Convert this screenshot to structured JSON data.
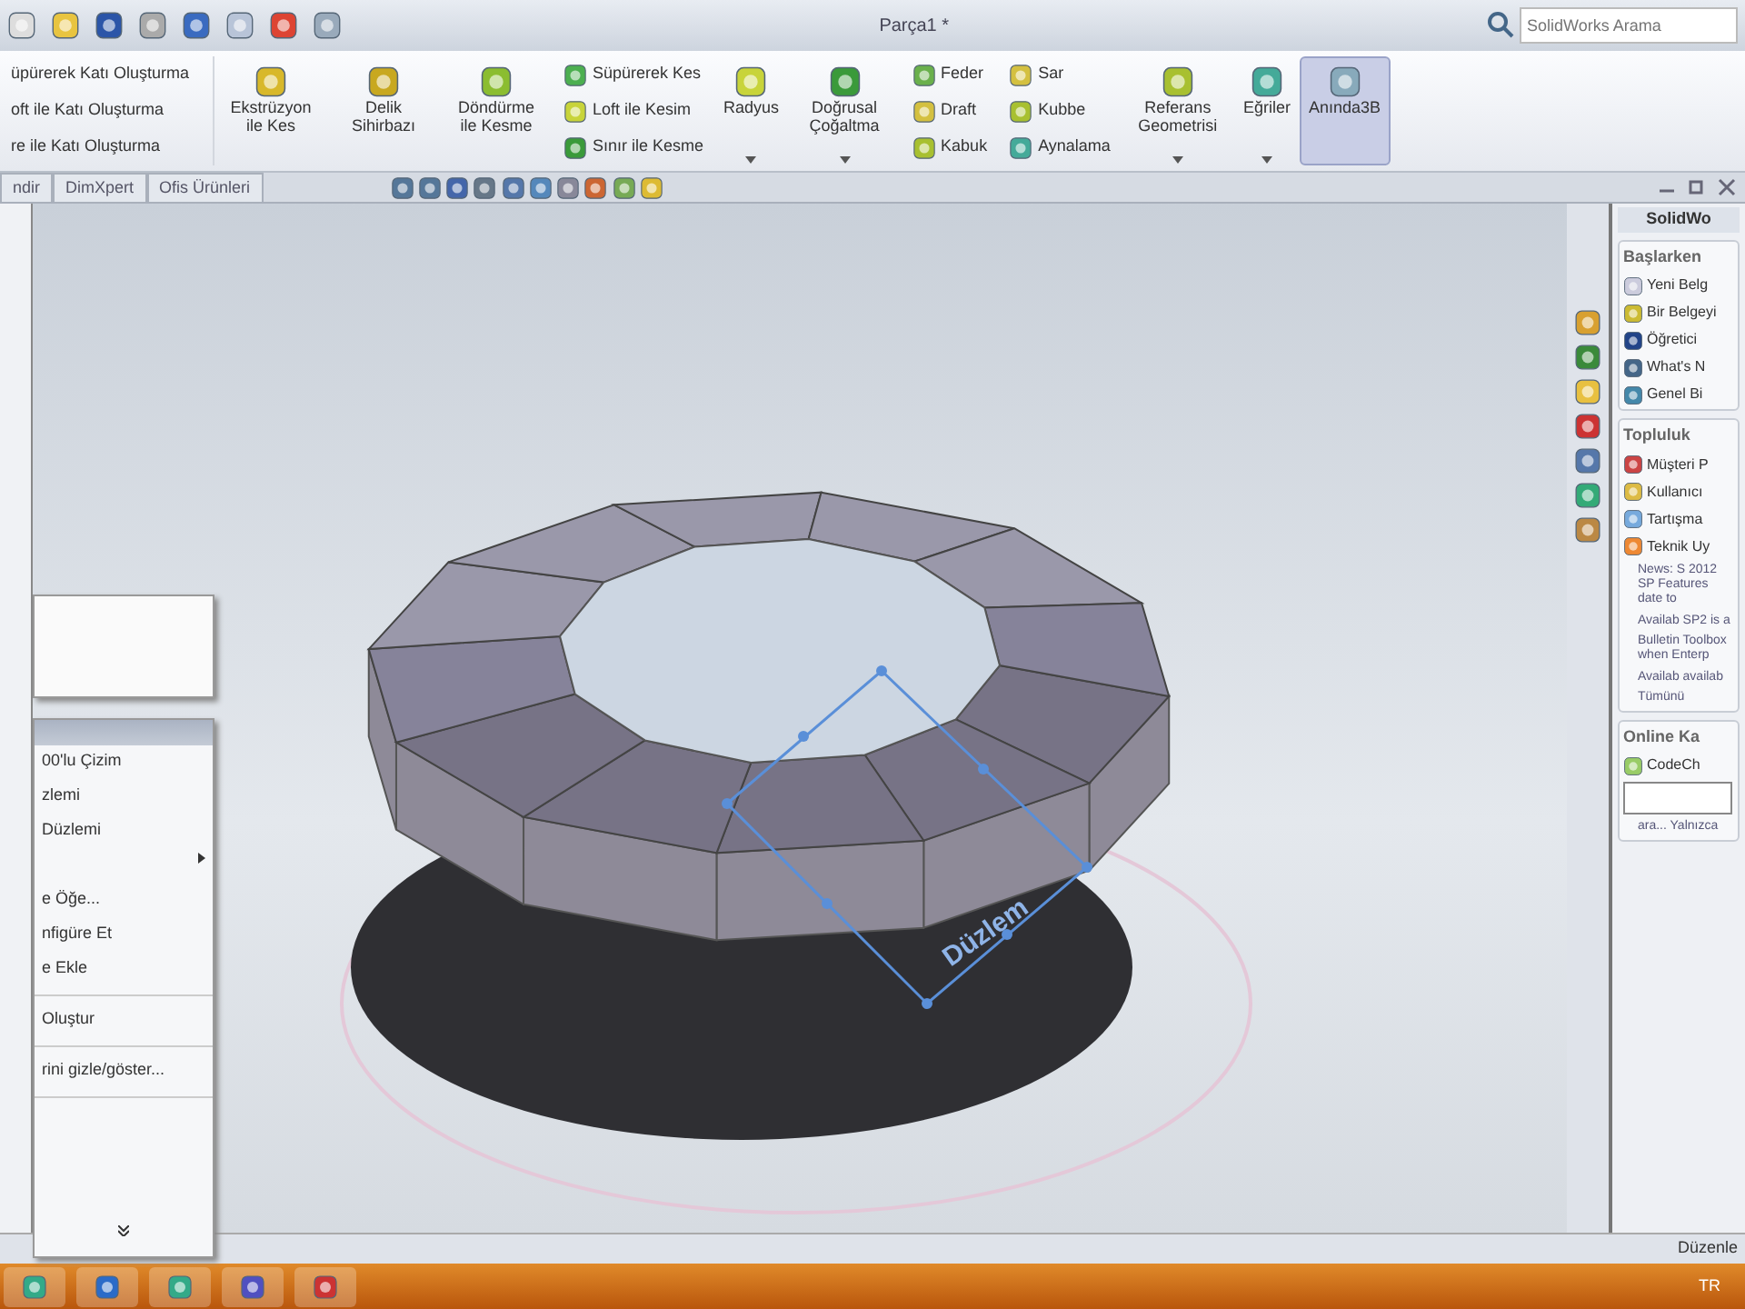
{
  "top_bar": {
    "title": "Parça1 *",
    "search": {
      "placeholder": "SolidWorks Arama"
    }
  },
  "ribbon": {
    "left_group": [
      "üpürerek Katı Oluşturma",
      "oft ile Katı Oluşturma",
      "re ile Katı Oluşturma"
    ],
    "groups": [
      {
        "kind": "large",
        "label": "Ekstrüzyon ile Kes",
        "on": false,
        "dropdown": false
      },
      {
        "kind": "large",
        "label": "Delik Sihirbazı",
        "on": false,
        "dropdown": false
      },
      {
        "kind": "large",
        "label": "Döndürme ile Kesme",
        "on": false,
        "dropdown": false
      },
      {
        "kind": "stack",
        "items": [
          "Süpürerek Kes",
          "Loft ile Kesim",
          "Sınır ile Kesme"
        ]
      },
      {
        "kind": "large",
        "label": "Radyus",
        "on": false,
        "dropdown": true
      },
      {
        "kind": "large",
        "label": "Doğrusal Çoğaltma",
        "on": false,
        "dropdown": true
      },
      {
        "kind": "stack",
        "items": [
          "Feder",
          "Draft",
          "Kabuk"
        ]
      },
      {
        "kind": "stack",
        "items": [
          "Sar",
          "Kubbe",
          "Aynalama"
        ]
      },
      {
        "kind": "large",
        "label": "Referans Geometrisi",
        "on": false,
        "dropdown": true
      },
      {
        "kind": "large",
        "label": "Eğriler",
        "on": false,
        "dropdown": true
      },
      {
        "kind": "large",
        "label": "Anında3B",
        "on": true,
        "dropdown": false
      }
    ]
  },
  "tabs": [
    {
      "label": "ndir"
    },
    {
      "label": "DimXpert"
    },
    {
      "label": "Ofis Ürünleri"
    }
  ],
  "context_menu": {
    "items": [
      {
        "kind": "header"
      },
      {
        "kind": "item",
        "label": "00'lu Çizim"
      },
      {
        "kind": "item",
        "label": "zlemi"
      },
      {
        "kind": "item",
        "label": "Düzlemi"
      },
      {
        "kind": "submenu"
      },
      {
        "kind": "item",
        "label": "e Öğe..."
      },
      {
        "kind": "item",
        "label": "nfigüre Et"
      },
      {
        "kind": "item",
        "label": "e Ekle"
      },
      {
        "kind": "separator"
      },
      {
        "kind": "item",
        "label": "Oluştur"
      },
      {
        "kind": "separator"
      },
      {
        "kind": "item",
        "label": "rini gizle/göster..."
      },
      {
        "kind": "separator"
      },
      {
        "kind": "expand"
      }
    ]
  },
  "viewport": {
    "plane_label": "Düzlem"
  },
  "task_pane": {
    "title": "SolidWo",
    "sections": [
      {
        "title": "Başlarken",
        "items": [
          "Yeni Belg",
          "Bir Belgeyi",
          "Öğretici",
          "What's N",
          "Genel Bi"
        ]
      },
      {
        "title": "Topluluk",
        "items": [
          "Müşteri P",
          "Kullanıcı",
          "Tartışma",
          "Teknik Uy"
        ],
        "news": [
          "News: S 2012 SP Features date to",
          "Availab SP2 is a",
          "Bulletin Toolbox when Enterp",
          "Availab availab"
        ],
        "more": "Tümünü"
      }
    ],
    "online": {
      "title": "Online Ka",
      "item": "CodeCh",
      "note": "ara... Yalnızca"
    }
  },
  "status_bar": {
    "text": "Düzenle"
  },
  "taskbar": {
    "language": "TR"
  }
}
